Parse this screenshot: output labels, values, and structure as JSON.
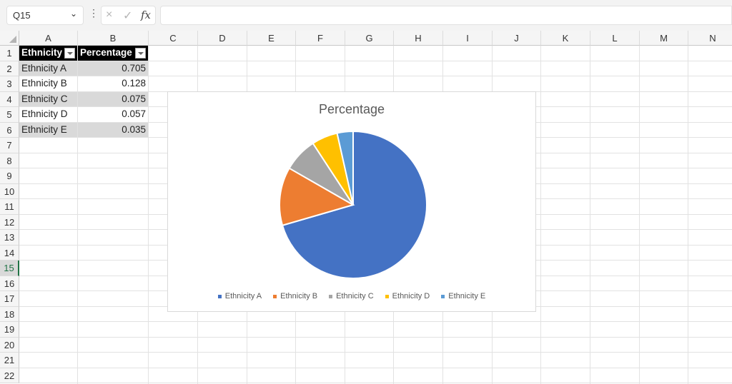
{
  "toolbar": {
    "name_box": "Q15",
    "name_box_icon": "chevron-down-icon",
    "cancel_icon": "×",
    "enter_icon": "✓",
    "fx_label": "fx",
    "formula_value": ""
  },
  "sheet": {
    "columns": [
      "A",
      "B",
      "C",
      "D",
      "E",
      "F",
      "G",
      "H",
      "I",
      "J",
      "K",
      "L",
      "M",
      "N"
    ],
    "rows": [
      "1",
      "2",
      "3",
      "4",
      "5",
      "6",
      "7",
      "8",
      "9",
      "10",
      "11",
      "12",
      "13",
      "14",
      "15",
      "16",
      "17",
      "18",
      "19",
      "20",
      "21",
      "22"
    ],
    "selected_row": "15",
    "table": {
      "headers": [
        "Ethnicity",
        "Percentage"
      ],
      "rows": [
        [
          "Ethnicity A",
          "0.705"
        ],
        [
          "Ethnicity B",
          "0.128"
        ],
        [
          "Ethnicity C",
          "0.075"
        ],
        [
          "Ethnicity D",
          "0.057"
        ],
        [
          "Ethnicity E",
          "0.035"
        ]
      ]
    }
  },
  "chart_data": {
    "type": "pie",
    "title": "Percentage",
    "categories": [
      "Ethnicity A",
      "Ethnicity B",
      "Ethnicity C",
      "Ethnicity D",
      "Ethnicity E"
    ],
    "values": [
      0.705,
      0.128,
      0.075,
      0.057,
      0.035
    ],
    "colors": [
      "#4472C4",
      "#ED7D31",
      "#A5A5A5",
      "#FFC000",
      "#5B9BD5"
    ],
    "start_angle_deg": 0,
    "direction": "clockwise",
    "legend_position": "bottom"
  }
}
